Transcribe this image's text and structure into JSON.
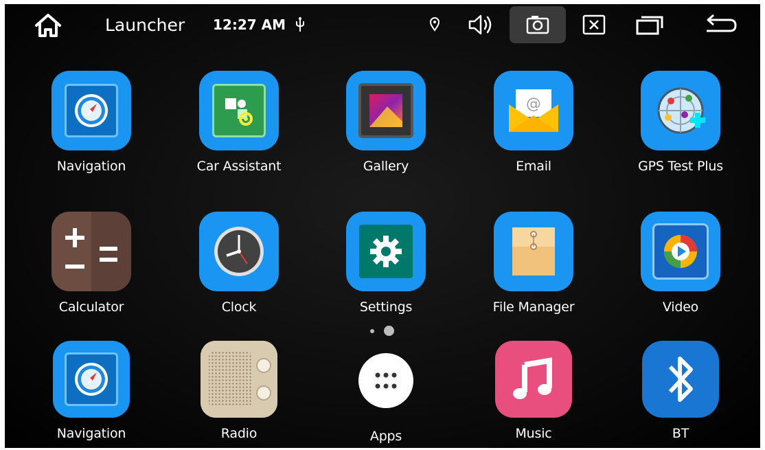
{
  "statusbar": {
    "title": "Launcher",
    "time": "12:27 AM",
    "icons": [
      "home-icon",
      "usb-icon",
      "location-icon",
      "volume-icon",
      "screenshot-icon",
      "close-icon",
      "recents-icon",
      "back-icon"
    ]
  },
  "apps": [
    {
      "label": "Navigation",
      "icon": "compass-icon"
    },
    {
      "label": "Car Assistant",
      "icon": "puzzle-gear-icon"
    },
    {
      "label": "Gallery",
      "icon": "picture-icon"
    },
    {
      "label": "Email",
      "icon": "envelope-icon"
    },
    {
      "label": "GPS Test Plus",
      "icon": "radar-icon"
    },
    {
      "label": "Calculator",
      "icon": "calculator-icon"
    },
    {
      "label": "Clock",
      "icon": "clock-icon"
    },
    {
      "label": "Settings",
      "icon": "gear-icon"
    },
    {
      "label": "File Manager",
      "icon": "folder-icon"
    },
    {
      "label": "Video",
      "icon": "play-icon"
    },
    {
      "label": "Navigation",
      "icon": "compass-icon"
    },
    {
      "label": "Radio",
      "icon": "radio-icon"
    },
    {
      "label": "Apps",
      "icon": "app-drawer-icon"
    },
    {
      "label": "Music",
      "icon": "music-note-icon"
    },
    {
      "label": "BT",
      "icon": "bluetooth-icon"
    }
  ],
  "pager": {
    "pages": 2,
    "current_page": 2
  },
  "colors": {
    "icon_bg": "#1a95f2",
    "background": "#000000",
    "text": "#ffffff"
  }
}
